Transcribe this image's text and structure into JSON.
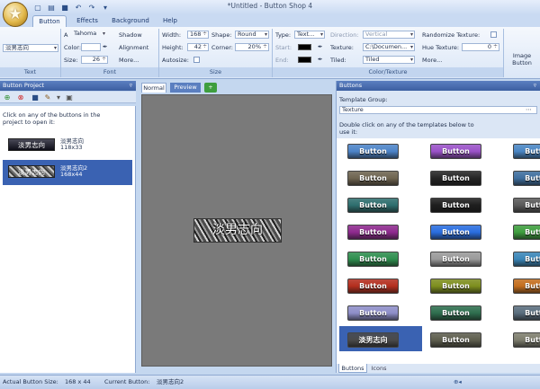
{
  "window": {
    "title": "*Untitled - Button Shop 4"
  },
  "qat": [
    "new-icon",
    "open-icon",
    "save-icon",
    "undo-icon",
    "redo-icon",
    "customize-icon"
  ],
  "tabs": [
    "Button",
    "Effects",
    "Background",
    "Help"
  ],
  "ribbon": {
    "text": {
      "value": "淡男志向",
      "title": "Text"
    },
    "font": {
      "title": "Font",
      "family": "Tahoma",
      "color_label": "Color:",
      "color_value": "#ffffff",
      "size_label": "Size:",
      "size_value": "26",
      "shadow": "Shadow",
      "alignment": "Alignment",
      "more": "More..."
    },
    "size": {
      "title": "Size",
      "width_label": "Width:",
      "width_value": "168",
      "height_label": "Height:",
      "height_value": "42",
      "autosize_label": "Autosize:",
      "shape_label": "Shape:",
      "shape_value": "Round",
      "corner_label": "Corner:",
      "corner_value": "20%"
    },
    "color_texture": {
      "title": "Color/Texture",
      "type_label": "Type:",
      "type_value": "Text...",
      "start_label": "Start:",
      "end_label": "End:",
      "direction_label": "Direction:",
      "direction_value": "Vertical",
      "texture_label": "Texture:",
      "texture_value": "C:\\Documen...",
      "tiled_label": "Tiled:",
      "tiled_value": "Tiled",
      "randomize_label": "Randomize Texture:",
      "hue_label": "Hue Texture:",
      "hue_value": "0",
      "more": "More..."
    },
    "image_button": "Image Button"
  },
  "left_pane": {
    "title": "Button Project",
    "hint": "Click on any of the buttons in the project to open it:",
    "items": [
      {
        "thumb_text": "淡男志向",
        "name": "淡男志向",
        "size": "118x33"
      },
      {
        "thumb_text": "淡男志向",
        "name": "淡男志向2",
        "size": "168x44"
      }
    ]
  },
  "center": {
    "tabs": [
      "Normal",
      "Preview",
      "+"
    ],
    "button_text": "淡男志向"
  },
  "right_pane": {
    "title": "Buttons",
    "group_label": "Template Group:",
    "group_value": "Texture",
    "hint": "Double click on any of the templates below to use it:",
    "tile_label": "Button",
    "tabs": [
      "Buttons",
      "Icons"
    ],
    "tiles": [
      [
        "#4d84c8",
        "#9a52c8",
        "#4a86c4"
      ],
      [
        "#6e6450",
        "#242424",
        "#3e6e9e"
      ],
      [
        "#2e6e6e",
        "#1e1e1e",
        "#5a5a5a"
      ],
      [
        "#8e2a8e",
        "#2a6ee0",
        "#3e9e3e"
      ],
      [
        "#2e8e4e",
        "#9a9a9a",
        "#3a86b8"
      ],
      [
        "#b42e1e",
        "#7e8e1e",
        "#c46e1e"
      ],
      [
        "#8e8ec8",
        "#2e6e4e",
        "#5a6e7e"
      ],
      [
        "#4a4a4a",
        "#5e5e4e",
        "#7e7e6e"
      ]
    ],
    "selected_tile_text": "淡男志向"
  },
  "status": {
    "actual_size_label": "Actual Button Size:",
    "actual_size": "168 x 44",
    "current_label": "Current Button:",
    "current": "淡男志向2"
  }
}
